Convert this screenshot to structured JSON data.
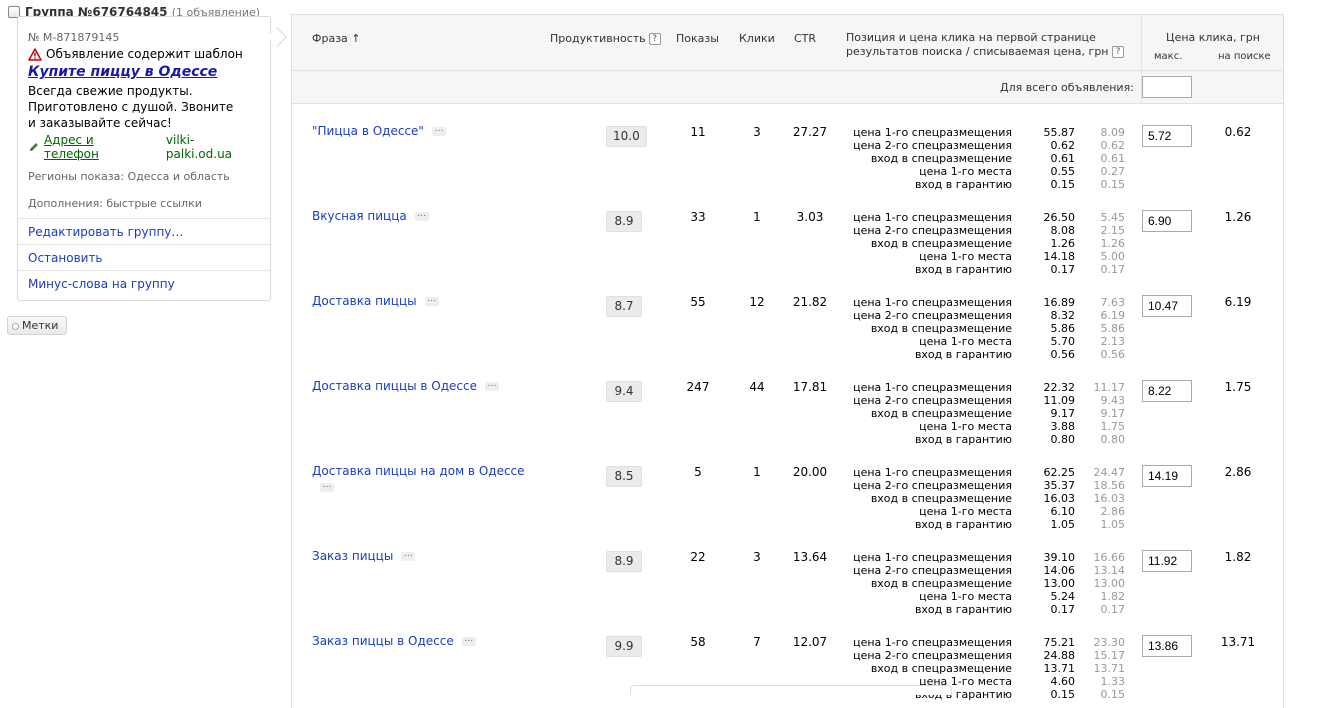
{
  "group": {
    "title": "Группа №676764845",
    "count": "(1 объявление)"
  },
  "ad": {
    "number": "№ М-871879145",
    "warning": "Объявление содержит шаблон",
    "title": "Купите пиццу в Одессе",
    "text_lines": [
      "Всегда свежие продукты.",
      "Приготовлено с душой. Звоните",
      "и заказывайте сейчас!"
    ],
    "contact_link": "Адрес и телефон",
    "domain": "vilki-palki.od.ua",
    "regions": "Регионы показа: Одесса и область",
    "addons": "Дополнения: быстрые ссылки"
  },
  "card_links": [
    "Редактировать группу…",
    "Остановить",
    "Минус-слова на группу"
  ],
  "tags_button": "Метки",
  "table": {
    "headers": {
      "phrase": "Фраза ↑",
      "productivity": "Продуктивность",
      "shows": "Показы",
      "clicks": "Клики",
      "ctr": "CTR",
      "position_line1": "Позиция и цена клика на первой странице",
      "position_line2": "результатов поиска / списываемая цена, грн",
      "price": "Цена клика, грн",
      "price_max": "макс.",
      "price_search": "на поиске"
    },
    "for_all_label": "Для всего объявления:",
    "for_all_value": "",
    "help_glyph": "?",
    "more_glyph": "…",
    "bid_labels": [
      "цена 1-го спецразмещения",
      "цена 2-го спецразмещения",
      "вход в спецразмещение",
      "цена 1-го места",
      "вход в гарантию"
    ],
    "rows": [
      {
        "phrase": "\"Пицца в Одессе\"",
        "productivity": "10.0",
        "shows": "11",
        "clicks": "3",
        "ctr": "27.27",
        "bids": [
          [
            "55.87",
            "8.09"
          ],
          [
            "0.62",
            "0.62"
          ],
          [
            "0.61",
            "0.61"
          ],
          [
            "0.55",
            "0.27"
          ],
          [
            "0.15",
            "0.15"
          ]
        ],
        "max_price": "5.72",
        "search_price": "0.62"
      },
      {
        "phrase": "Вкусная пицца",
        "productivity": "8.9",
        "shows": "33",
        "clicks": "1",
        "ctr": "3.03",
        "bids": [
          [
            "26.50",
            "5.45"
          ],
          [
            "8.08",
            "2.15"
          ],
          [
            "1.26",
            "1.26"
          ],
          [
            "14.18",
            "5.00"
          ],
          [
            "0.17",
            "0.17"
          ]
        ],
        "max_price": "6.90",
        "search_price": "1.26"
      },
      {
        "phrase": "Доставка пиццы",
        "productivity": "8.7",
        "shows": "55",
        "clicks": "12",
        "ctr": "21.82",
        "bids": [
          [
            "16.89",
            "7.63"
          ],
          [
            "8.32",
            "6.19"
          ],
          [
            "5.86",
            "5.86"
          ],
          [
            "5.70",
            "2.13"
          ],
          [
            "0.56",
            "0.56"
          ]
        ],
        "max_price": "10.47",
        "search_price": "6.19"
      },
      {
        "phrase": "Доставка пиццы в Одессе",
        "productivity": "9.4",
        "shows": "247",
        "clicks": "44",
        "ctr": "17.81",
        "bids": [
          [
            "22.32",
            "11.17"
          ],
          [
            "11.09",
            "9.43"
          ],
          [
            "9.17",
            "9.17"
          ],
          [
            "3.88",
            "1.75"
          ],
          [
            "0.80",
            "0.80"
          ]
        ],
        "max_price": "8.22",
        "search_price": "1.75"
      },
      {
        "phrase": "Доставка пиццы на дом в Одессе",
        "productivity": "8.5",
        "shows": "5",
        "clicks": "1",
        "ctr": "20.00",
        "bids": [
          [
            "62.25",
            "24.47"
          ],
          [
            "35.37",
            "18.56"
          ],
          [
            "16.03",
            "16.03"
          ],
          [
            "6.10",
            "2.86"
          ],
          [
            "1.05",
            "1.05"
          ]
        ],
        "max_price": "14.19",
        "search_price": "2.86"
      },
      {
        "phrase": "Заказ пиццы",
        "productivity": "8.9",
        "shows": "22",
        "clicks": "3",
        "ctr": "13.64",
        "bids": [
          [
            "39.10",
            "16.66"
          ],
          [
            "14.06",
            "13.14"
          ],
          [
            "13.00",
            "13.00"
          ],
          [
            "5.24",
            "1.82"
          ],
          [
            "0.17",
            "0.17"
          ]
        ],
        "max_price": "11.92",
        "search_price": "1.82"
      },
      {
        "phrase": "Заказ пиццы в Одессе",
        "productivity": "9.9",
        "shows": "58",
        "clicks": "7",
        "ctr": "12.07",
        "bids": [
          [
            "75.21",
            "23.30"
          ],
          [
            "24.88",
            "15.17"
          ],
          [
            "13.71",
            "13.71"
          ],
          [
            "4.60",
            "1.33"
          ],
          [
            "0.15",
            "0.15"
          ]
        ],
        "max_price": "13.86",
        "search_price": "13.71"
      }
    ]
  },
  "colors": {
    "link": "#1a3dc1",
    "ad_title": "#1a1aa6",
    "contact": "#006600",
    "warning": "#cc0000",
    "header_bg": "#f6f6f6"
  },
  "icons": {
    "warning": "warning-triangle-icon",
    "contact": "pencil-icon",
    "tags": "tag-icon"
  }
}
